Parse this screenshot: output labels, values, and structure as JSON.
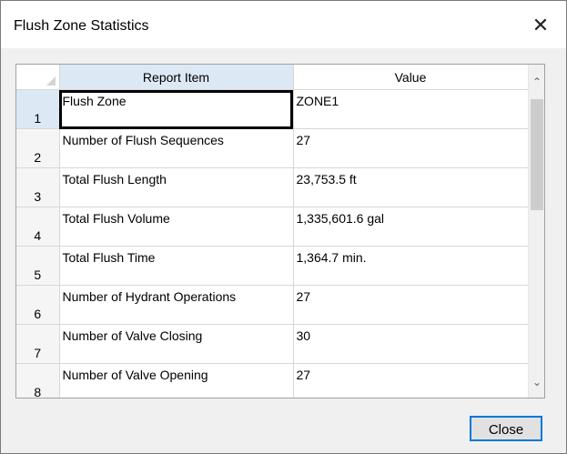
{
  "window": {
    "title": "Flush Zone Statistics",
    "close_glyph": "✕"
  },
  "grid": {
    "columns": [
      "Report Item",
      "Value"
    ],
    "rows": [
      {
        "num": "1",
        "item": "Flush Zone",
        "value": "ZONE1"
      },
      {
        "num": "2",
        "item": "Number of Flush Sequences",
        "value": "27"
      },
      {
        "num": "3",
        "item": "Total Flush Length",
        "value": "23,753.5 ft"
      },
      {
        "num": "4",
        "item": "Total Flush Volume",
        "value": "1,335,601.6 gal"
      },
      {
        "num": "5",
        "item": "Total Flush Time",
        "value": "1,364.7 min."
      },
      {
        "num": "6",
        "item": "Number of Hydrant Operations",
        "value": "27"
      },
      {
        "num": "7",
        "item": "Number of Valve Closing",
        "value": "30"
      },
      {
        "num": "8",
        "item": "Number of Valve Opening",
        "value": "27"
      },
      {
        "num": "",
        "item": "",
        "value": ""
      }
    ],
    "scroll_up_glyph": "⌃",
    "scroll_down_glyph": "⌄"
  },
  "footer": {
    "close_label": "Close"
  }
}
